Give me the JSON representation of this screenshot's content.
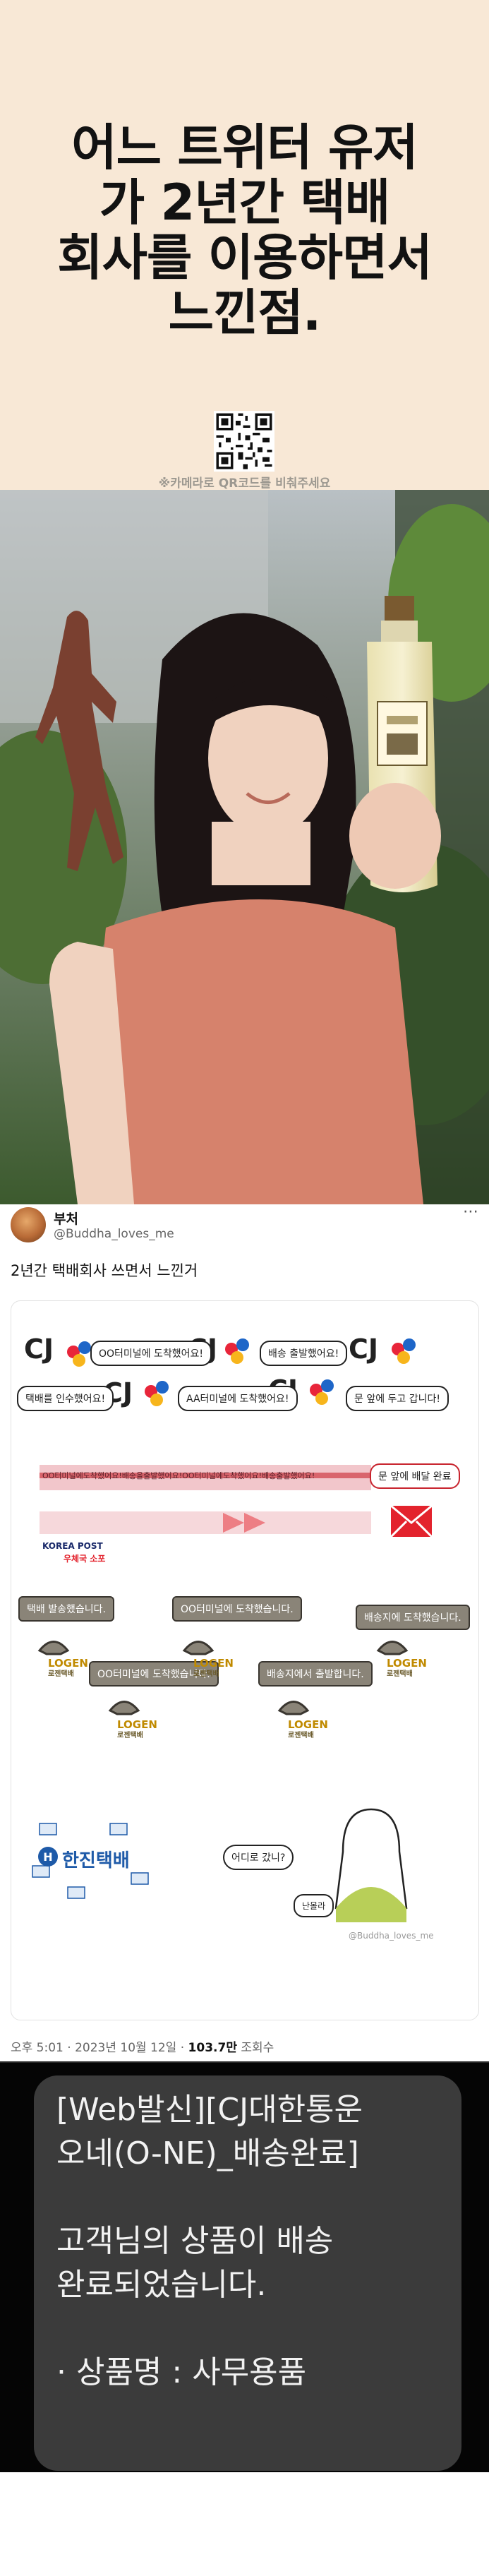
{
  "header": {
    "title_lines": [
      "어느 트위터 유저",
      "가 2년간 택배",
      "회사를 이용하면서",
      "느낀점."
    ],
    "qr_caption": "※카메라로 QR코드를 비춰주세요",
    "background": "#f8e8d6"
  },
  "tweet": {
    "user_name": "부처",
    "user_handle": "@Buddha_loves_me",
    "more_icon": "⋯",
    "text": "2년간 택배회사 쓰면서 느낀거",
    "meta_time": "오후 5:01 · 2023년 10월 12일 · ",
    "meta_views": "103.7만",
    "meta_views_label": " 조회수"
  },
  "comic": {
    "cj_label": "CJ",
    "cj_bubbles": [
      "OO터미널에 도착했어요!",
      "배송 출발했어요!",
      "택배를 인수했어요!",
      "AA터미널에 도착했어요!",
      "문 앞에 두고 갑니다!"
    ],
    "post_track": "OO터미널에도착했어요!배송을출발했어요!OO터미널에도착했어요!배송출발했어요!",
    "post_done": "문 앞에 배달 완료",
    "korea_post": "KOREA POST",
    "korea_post_sub": "우체국 소포",
    "logen_signs": [
      "택배 발송했습니다.",
      "OO터미널에 도착했습니다.",
      "배송지에 도착했습니다.",
      "OO터미널에 도착했습니다.",
      "배송지에서 출발합니다."
    ],
    "logen_logo": "LOGEN",
    "logen_sub": "로젠택배",
    "hanjin": "한진택배",
    "hanjin_bubble": "어디로 갔니?",
    "hanjin_reply": "난몰라",
    "watermark": "@Buddha_loves_me",
    "colors": {
      "cj_red": "#e8253a",
      "cj_blue": "#1e66c8",
      "cj_yellow": "#f7b51c",
      "post_red": "#e3232d",
      "logen_gold": "#c08a00",
      "hanjin_blue": "#1e5aa8"
    }
  },
  "sms": {
    "lines": [
      "[Web발신][CJ대한통운",
      "오네(O-NE)_배송완료]",
      "",
      "고객님의 상품이 배송",
      "완료되었습니다.",
      "",
      "· 상품명 : 사무용품"
    ]
  }
}
